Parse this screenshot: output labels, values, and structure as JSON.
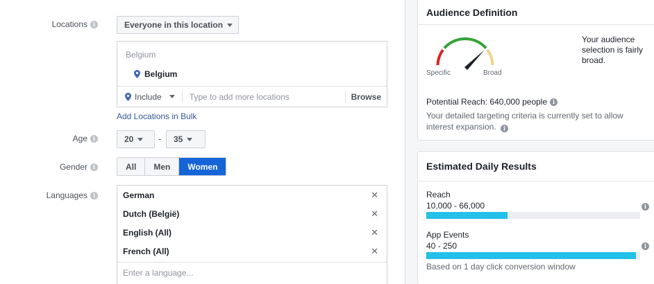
{
  "targeting": {
    "locations": {
      "label": "Locations",
      "audience_select": "Everyone in this location",
      "group_header": "Belgium",
      "items": [
        "Belgium"
      ],
      "include_label": "Include",
      "input_placeholder": "Type to add more locations",
      "browse_label": "Browse",
      "bulk_link": "Add Locations in Bulk"
    },
    "age": {
      "label": "Age",
      "min": "20",
      "separator": "-",
      "max": "35"
    },
    "gender": {
      "label": "Gender",
      "options": [
        "All",
        "Men",
        "Women"
      ],
      "selected": "Women"
    },
    "languages": {
      "label": "Languages",
      "items": [
        "German",
        "Dutch (België)",
        "English (All)",
        "French (All)"
      ],
      "input_placeholder": "Enter a language..."
    }
  },
  "audience_definition": {
    "title": "Audience Definition",
    "gauge_left": "Specific",
    "gauge_right": "Broad",
    "description": "Your audience selection is fairly broad.",
    "potential_reach": "Potential Reach: 640,000 people",
    "detail": "Your detailed targeting criteria is currently set to allow interest expansion."
  },
  "daily_results": {
    "title": "Estimated Daily Results",
    "metrics": [
      {
        "name": "Reach",
        "range": "10,000 - 66,000",
        "fill_fraction": 0.38
      },
      {
        "name": "App Events",
        "range": "40 - 250",
        "fill_fraction": 0.98
      }
    ],
    "note": "Based on 1 day click conversion window"
  },
  "colors": {
    "accent_blue": "#1665d8",
    "link_blue": "#365899",
    "bar_fill": "#23c0e8",
    "gauge_red": "#e02020",
    "gauge_green": "#35a33a",
    "gauge_yellow": "#f0d48a"
  }
}
